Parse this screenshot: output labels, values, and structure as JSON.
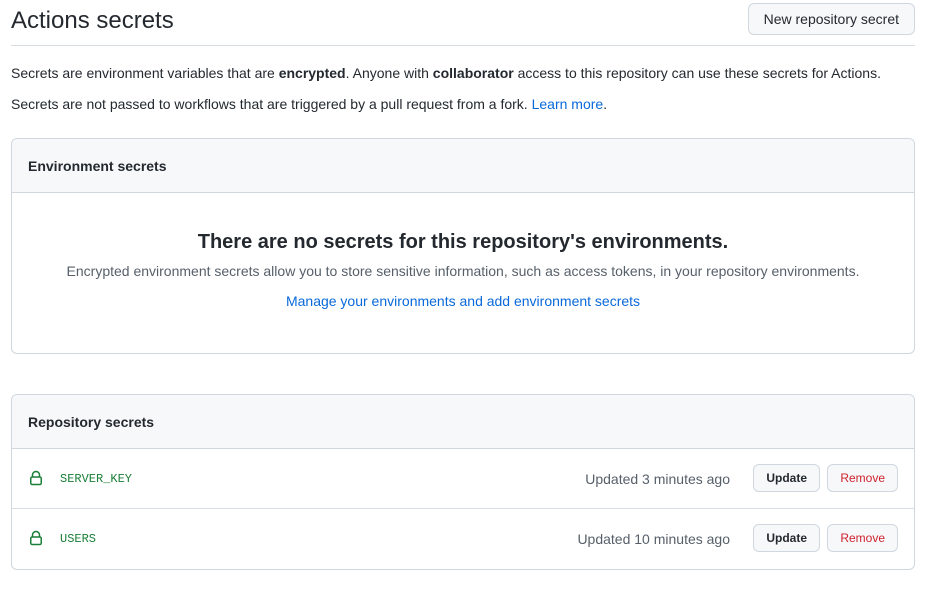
{
  "header": {
    "title": "Actions secrets",
    "new_secret_label": "New repository secret"
  },
  "description": {
    "line1_part1": "Secrets are environment variables that are ",
    "line1_bold1": "encrypted",
    "line1_part2": ". Anyone with ",
    "line1_bold2": "collaborator",
    "line1_part3": " access to this repository can use these secrets for Actions.",
    "line2_text": "Secrets are not passed to workflows that are triggered by a pull request from a fork. ",
    "line2_link": "Learn more",
    "line2_end": "."
  },
  "environment_secrets": {
    "title": "Environment secrets",
    "blank_title": "There are no secrets for this repository's environments.",
    "blank_description": "Encrypted environment secrets allow you to store sensitive information, such as access tokens, in your repository environments.",
    "blank_link": "Manage your environments and add environment secrets"
  },
  "repository_secrets": {
    "title": "Repository secrets",
    "items": [
      {
        "icon": "lock-icon",
        "name": "SERVER_KEY",
        "updated": "Updated 3 minutes ago",
        "update_label": "Update",
        "remove_label": "Remove"
      },
      {
        "icon": "lock-icon",
        "name": "USERS",
        "updated": "Updated 10 minutes ago",
        "update_label": "Update",
        "remove_label": "Remove"
      }
    ]
  },
  "colors": {
    "link": "#0969da",
    "secret_name": "#1a7f37",
    "remove": "#cf222e",
    "muted": "#57606a"
  }
}
